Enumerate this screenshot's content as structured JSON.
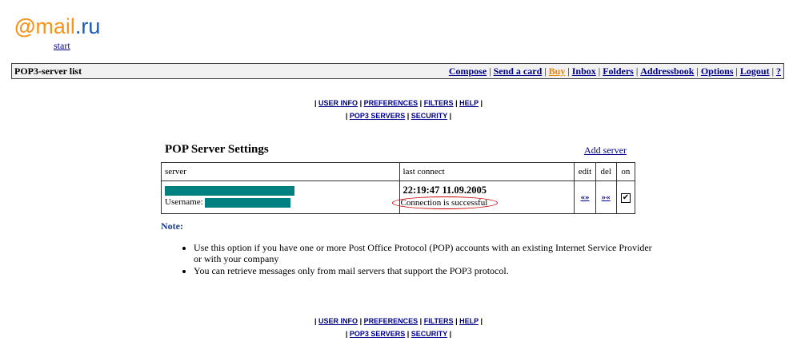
{
  "logo": {
    "prefix": "@",
    "name": "mail",
    "suffix": ".ru"
  },
  "start_link": "start",
  "topbar": {
    "title": "POP3-server list",
    "nav": [
      "Compose",
      "Send a card",
      "Buy",
      "Inbox",
      "Folders",
      "Addressbook",
      "Options",
      "Logout",
      "?"
    ],
    "separator": "|"
  },
  "subnav": {
    "row1": [
      "USER INFO",
      "PREFERENCES",
      "FILTERS",
      "HELP"
    ],
    "row2": [
      "POP3 SERVERS",
      "SECURITY"
    ],
    "separator": "|"
  },
  "settings": {
    "title": "POP Server Settings",
    "add_server": "Add server",
    "columns": {
      "server": "server",
      "last_connect": "last connect",
      "edit": "edit",
      "del": "del",
      "on": "on"
    },
    "row": {
      "username_label": "Username:",
      "last_connect_time": "22:19:47 11.09.2005",
      "status": "Connection is successful",
      "edit_icon": "«»",
      "del_icon": "»«",
      "on_checked": true,
      "check_mark": "✔"
    }
  },
  "note": {
    "label": "Note:",
    "items": [
      "Use this option if you have one or more Post Office Protocol (POP) accounts with an existing Internet Service Provider or with your company",
      "You can retrieve messages only from mail servers that support the POP3 protocol."
    ]
  },
  "colors": {
    "brand_orange": "#f7941d",
    "brand_blue": "#1a5bb8",
    "link": "#00008b",
    "redacted": "#008080",
    "highlight_circle": "#cc0000"
  }
}
